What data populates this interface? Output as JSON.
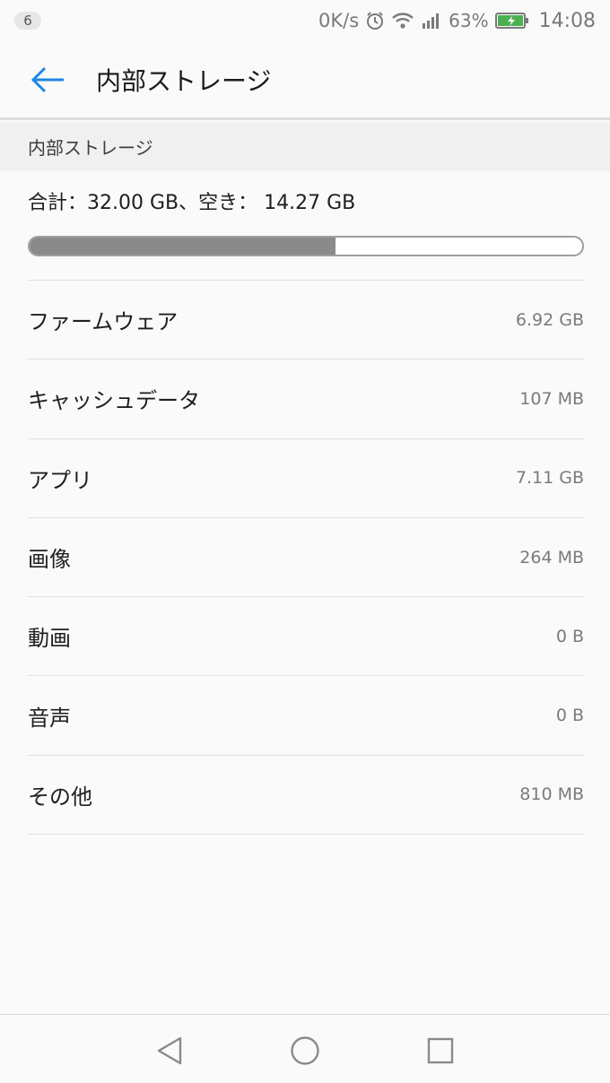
{
  "status_bar": {
    "notification_count": "6",
    "network_speed": "0K/s",
    "battery_percent": "63%",
    "time": "14:08",
    "icons": [
      "alarm-icon",
      "wifi-icon",
      "signal-icon",
      "battery-charging-icon"
    ],
    "battery_color": "#4caf50"
  },
  "app_bar": {
    "title": "内部ストレージ",
    "back_icon": "back-arrow-icon",
    "accent_color": "#1e88e5"
  },
  "section": {
    "header": "内部ストレージ",
    "summary": "合計：32.00 GB、空き： 14.27 GB",
    "used_fraction": 0.554
  },
  "rows": [
    {
      "label": "ファームウェア",
      "value": "6.92 GB"
    },
    {
      "label": "キャッシュデータ",
      "value": "107 MB"
    },
    {
      "label": "アプリ",
      "value": "7.11 GB"
    },
    {
      "label": "画像",
      "value": "264 MB"
    },
    {
      "label": "動画",
      "value": "0 B"
    },
    {
      "label": "音声",
      "value": "0 B"
    },
    {
      "label": "その他",
      "value": "810 MB"
    }
  ],
  "nav_bar": {
    "icons": [
      "back-triangle-icon",
      "home-circle-icon",
      "recents-square-icon"
    ]
  }
}
